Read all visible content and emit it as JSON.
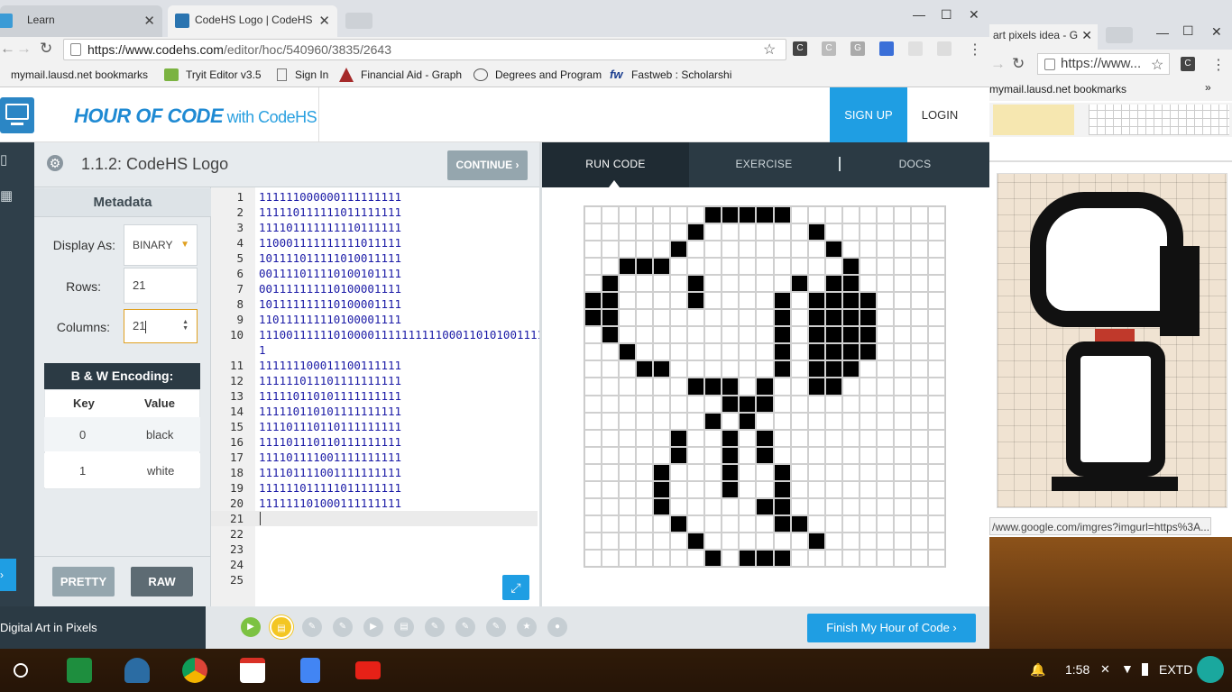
{
  "browser": {
    "tabs": [
      {
        "label": "Learn"
      },
      {
        "label": "CodeHS Logo | CodeHS"
      }
    ],
    "url_host": "https://www.codehs.com",
    "url_path": "/editor/hoc/540960/3835/2643",
    "bookmarks": [
      "mymail.lausd.net bookmarks",
      "Tryit Editor v3.5",
      "Sign In",
      "Financial Aid - Graph",
      "Degrees and Program",
      "Fastweb : Scholarshi"
    ]
  },
  "site": {
    "logo_main": "HOUR OF CODE",
    "logo_sub": " with CodeHS",
    "signup": "SIGN UP",
    "login": "LOGIN"
  },
  "exercise": {
    "title": "1.1.2: CodeHS Logo",
    "continue": "CONTINUE ›"
  },
  "metadata": {
    "title": "Metadata",
    "display_label": "Display As:",
    "display_value": "BINARY",
    "rows_label": "Rows:",
    "rows_value": "21",
    "cols_label": "Columns:",
    "cols_value": "21"
  },
  "encoding": {
    "title": "B & W Encoding:",
    "key_header": "Key",
    "value_header": "Value",
    "rows": [
      {
        "key": "0",
        "value": "black"
      },
      {
        "key": "1",
        "value": "white"
      }
    ]
  },
  "buttons": {
    "pretty": "PRETTY",
    "raw": "RAW"
  },
  "editor": {
    "line_numbers": [
      "1",
      "2",
      "3",
      "4",
      "5",
      "6",
      "7",
      "8",
      "9",
      "10",
      "",
      "11",
      "12",
      "13",
      "14",
      "15",
      "16",
      "17",
      "18",
      "19",
      "20",
      "21",
      "22",
      "23",
      "24",
      "25"
    ],
    "lines": [
      "111111000000111111111",
      "111110111111011111111",
      "111101111111110111111",
      "110001111111111011111",
      "101111011111010011111",
      "001111011110100101111",
      "001111111110100001111",
      "101111111110100001111",
      "110111111110100001111",
      "1110011111101000011111111110001101010011111",
      "111111100011100111111",
      "111111011101111111111",
      "111110110101111111111",
      "111110110101111111111",
      "111101110110111111111",
      "111101110110111111111",
      "111101111001111111111",
      "111101111001111111111",
      "111111011111011111111",
      "111111101000111111111"
    ]
  },
  "right_tabs": {
    "run": "RUN CODE",
    "exercise": "EXERCISE",
    "docs": "DOCS"
  },
  "grid_rows": [
    "111111100000111111111",
    "111111011111101111111",
    "111110111111110111111",
    "110001111111111011111",
    "101111011111010011111",
    "001111011110100001111",
    "001111111110100001111",
    "101111111110100001111",
    "110111111110100001111",
    "111001111110100011111",
    "111111000101100111111",
    "111111110001111111111",
    "111111101011111111111",
    "111110110101111111111",
    "111110110101111111111",
    "111101110110111111111",
    "111101110110111111111",
    "111101111100111111111",
    "111110111110011111111",
    "111111011111101111111",
    "111111101000111111111"
  ],
  "footer": {
    "lesson": "Digital Art in Pixels",
    "finish": "Finish My Hour of Code ›"
  },
  "window2": {
    "tab_label": "art pixels idea - G",
    "url": "https://www...",
    "bookmarks": "mymail.lausd.net bookmarks",
    "status": "/www.google.com/imgres?imgurl=https%3A..."
  },
  "taskbar": {
    "time": "1:58",
    "extd": "EXTD"
  },
  "colors": {
    "accent": "#1f9ee3",
    "dark": "#2b3a44"
  }
}
